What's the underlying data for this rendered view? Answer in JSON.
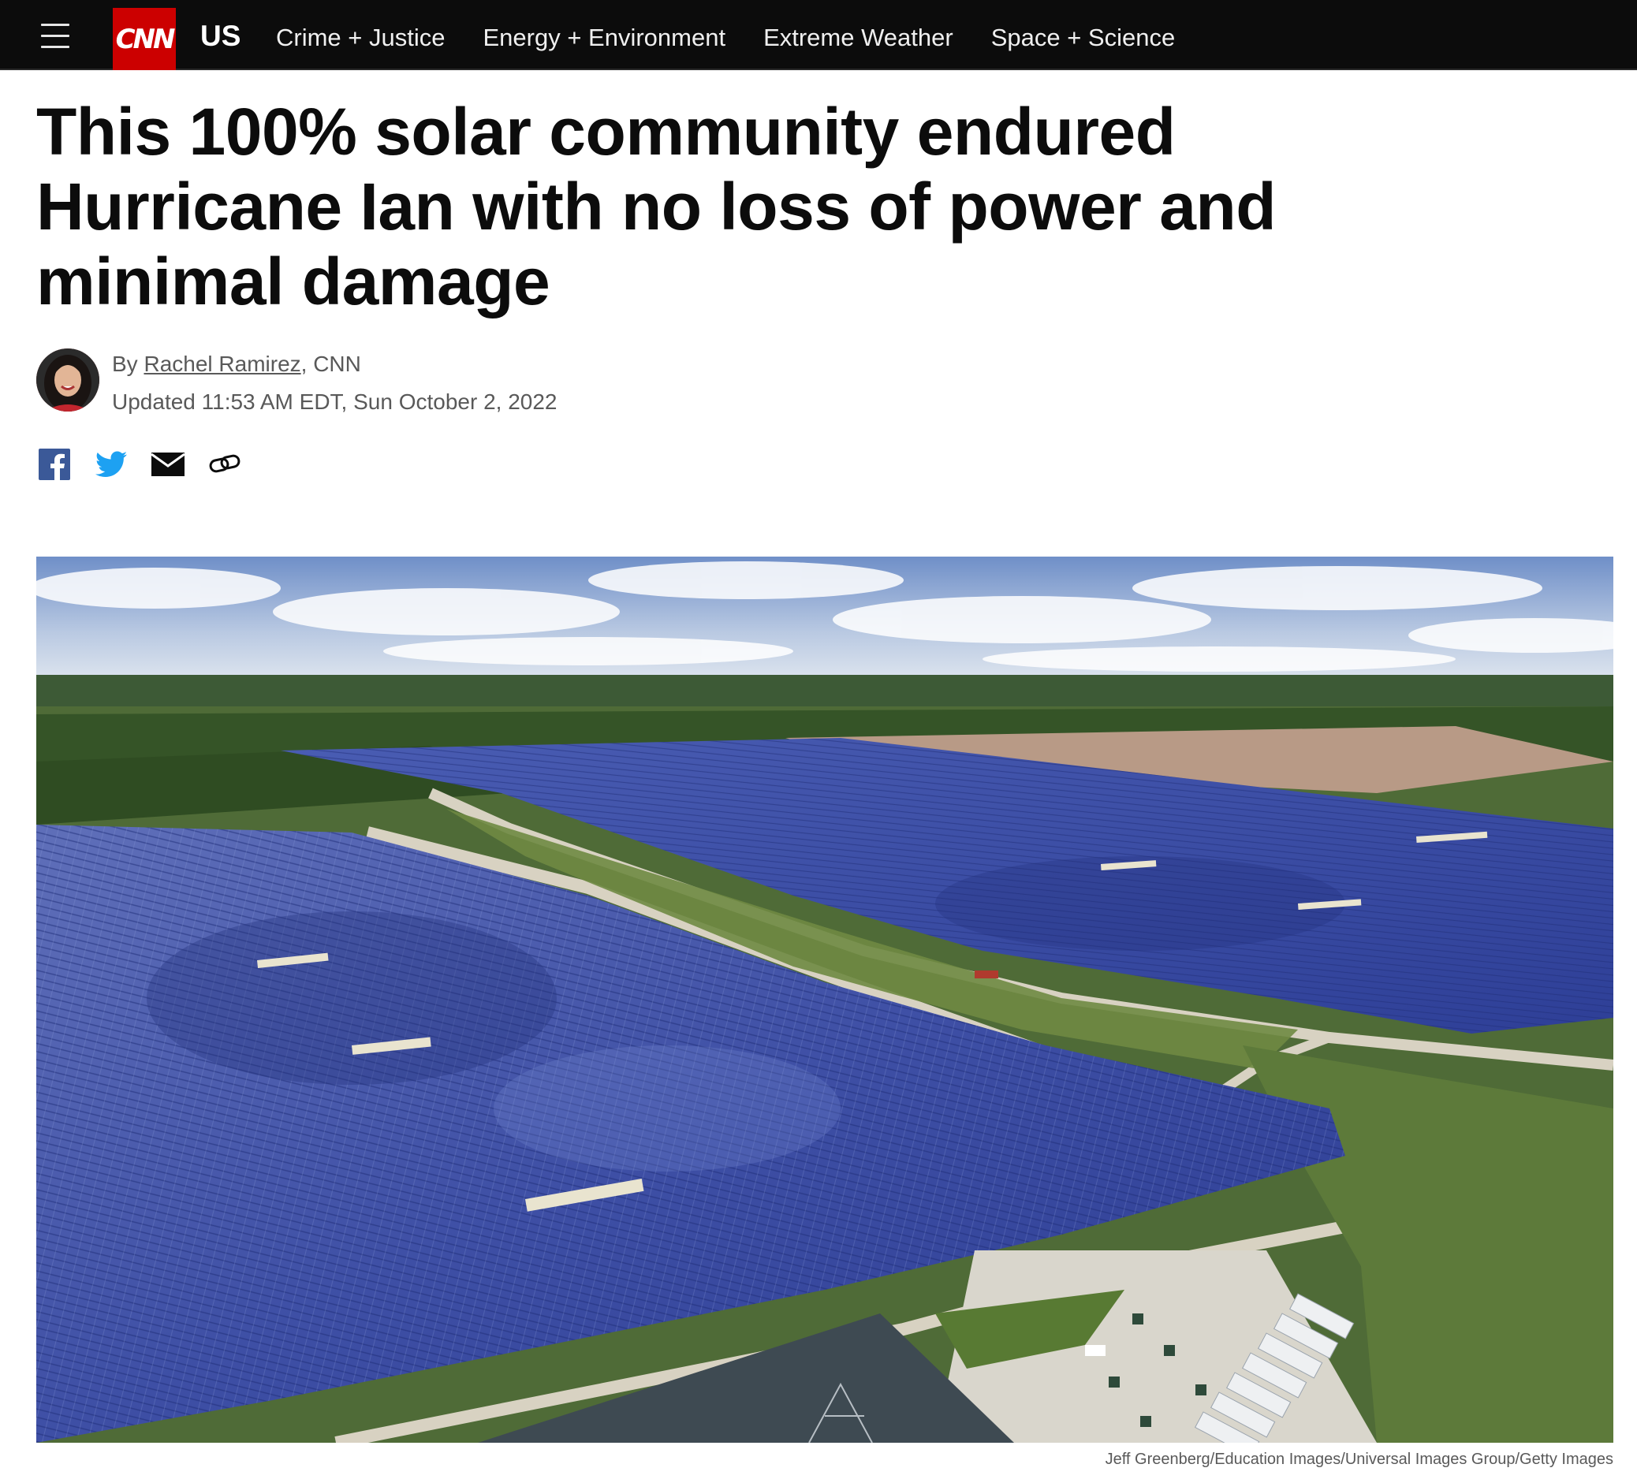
{
  "nav": {
    "logo": "CNN",
    "section": "US",
    "links": [
      "Crime + Justice",
      "Energy + Environment",
      "Extreme Weather",
      "Space + Science"
    ]
  },
  "article": {
    "headline": "This 100% solar community endured Hurricane Ian with no loss of power and minimal damage",
    "byline_prefix": "By ",
    "author": "Rachel Ramirez",
    "byline_suffix": ", CNN",
    "updated": "Updated 11:53 AM EDT, Sun October 2, 2022"
  },
  "share": {
    "icons": [
      "facebook-icon",
      "twitter-icon",
      "email-icon",
      "link-icon"
    ]
  },
  "image": {
    "credit": "Jeff Greenberg/Education Images/Universal Images Group/Getty Images"
  },
  "colors": {
    "brand_red": "#cc0000",
    "nav_bg": "#0c0c0c",
    "facebook": "#3b5998",
    "twitter": "#1da1f2"
  }
}
